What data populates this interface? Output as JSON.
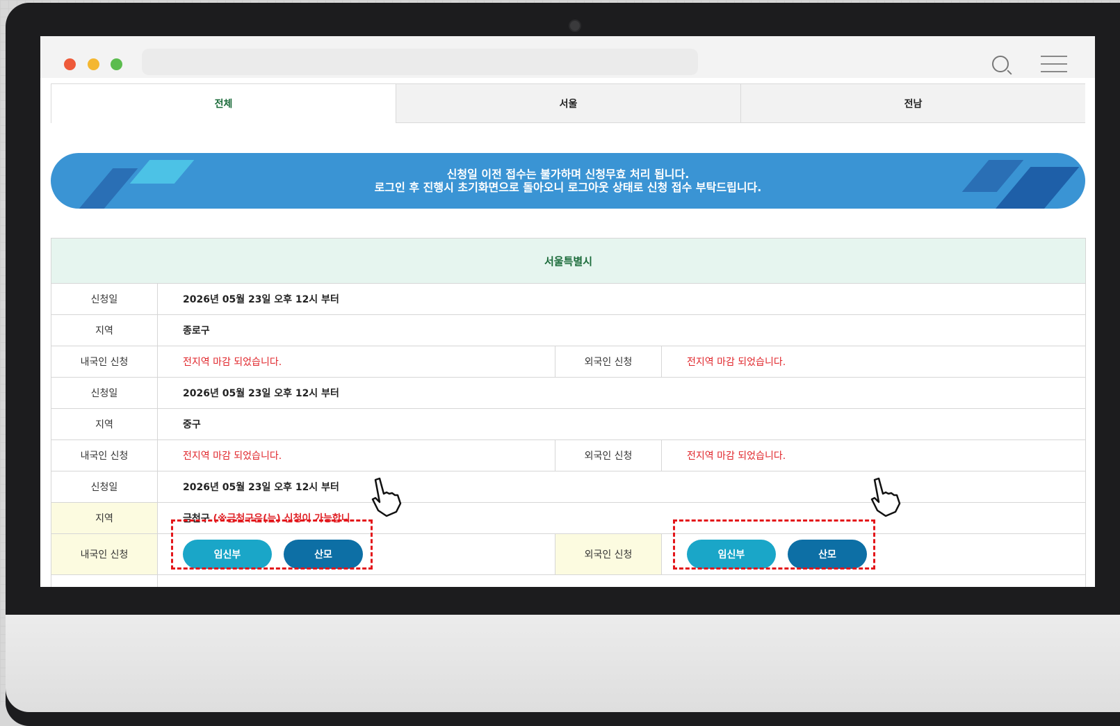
{
  "tabs": [
    {
      "label": "전체",
      "active": true
    },
    {
      "label": "서울",
      "active": false
    },
    {
      "label": "전남",
      "active": false
    }
  ],
  "banner": {
    "line1": "신청일 이전 접수는 불가하며 신청무효 처리 됩니다.",
    "line2": "로그인 후 진행시 초기화면으로 돌아오니 로그아웃 상태로 신청 접수 부탁드립니다."
  },
  "table": {
    "header": "서울특별시",
    "labels": {
      "date": "신청일",
      "region": "지역",
      "domestic": "내국인 신청",
      "foreign": "외국인 신청"
    },
    "entries": [
      {
        "date": "2026년 05월 23일 오후 12시 부터",
        "region": "종로구",
        "domestic_status": "전지역 마감 되었습니다.",
        "foreign_status": "전지역 마감 되었습니다."
      },
      {
        "date": "2026년 05월 23일 오후 12시 부터",
        "region": "중구",
        "domestic_status": "전지역 마감 되었습니다.",
        "foreign_status": "전지역 마감 되었습니다."
      },
      {
        "date": "2026년 05월 23일 오후 12시 부터",
        "region": "금천구",
        "region_note": "(※금천구은(는) 신청이 가능합니",
        "buttons": {
          "pregnant": "임신부",
          "mother": "산모"
        }
      }
    ]
  },
  "colors": {
    "banner": "#3a94d4",
    "closed_text": "#e0262b",
    "header_bg": "#e6f5ef",
    "highlight_bg": "#fcfbe0",
    "pill_pregnant": "#1aa6c8",
    "pill_mother": "#0d6fa5",
    "dashed_highlight": "#e3151a"
  },
  "icons": [
    "search-icon",
    "menu-icon",
    "pointing-hand-icon"
  ]
}
